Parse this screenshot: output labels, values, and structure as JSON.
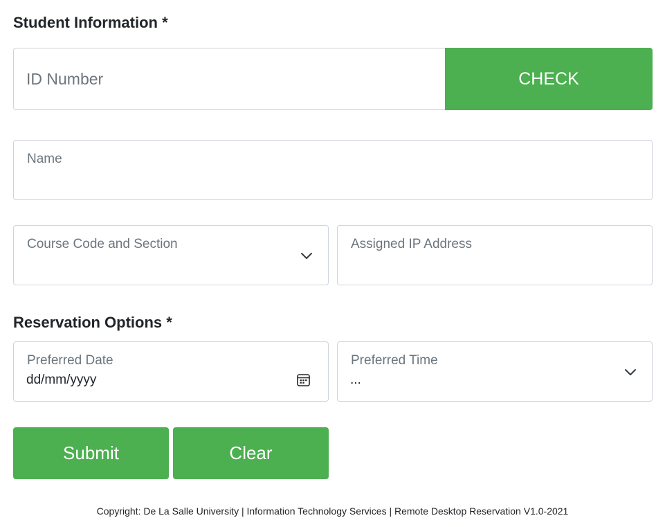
{
  "sections": {
    "student_information": "Student Information *",
    "reservation_options": "Reservation Options *"
  },
  "id_number": {
    "placeholder": "ID Number",
    "value": "",
    "check_label": "CHECK"
  },
  "name_field": {
    "label": "Name",
    "value": ""
  },
  "course_field": {
    "label": "Course Code and Section",
    "value": "",
    "icon": "chevron-down-icon"
  },
  "ip_field": {
    "label": "Assigned IP Address",
    "value": ""
  },
  "date_field": {
    "label": "Preferred Date",
    "value": "dd/mm/yyyy",
    "icon": "calendar-icon"
  },
  "time_field": {
    "label": "Preferred Time",
    "value": "...",
    "icon": "chevron-down-icon"
  },
  "actions": {
    "submit_label": "Submit",
    "clear_label": "Clear"
  },
  "footer": {
    "text": "Copyright: De La Salle University | Information Technology Services | Remote Desktop Reservation V1.0-2021"
  },
  "colors": {
    "accent": "#4caf50",
    "border": "#ced4da",
    "label": "#6c757d"
  }
}
